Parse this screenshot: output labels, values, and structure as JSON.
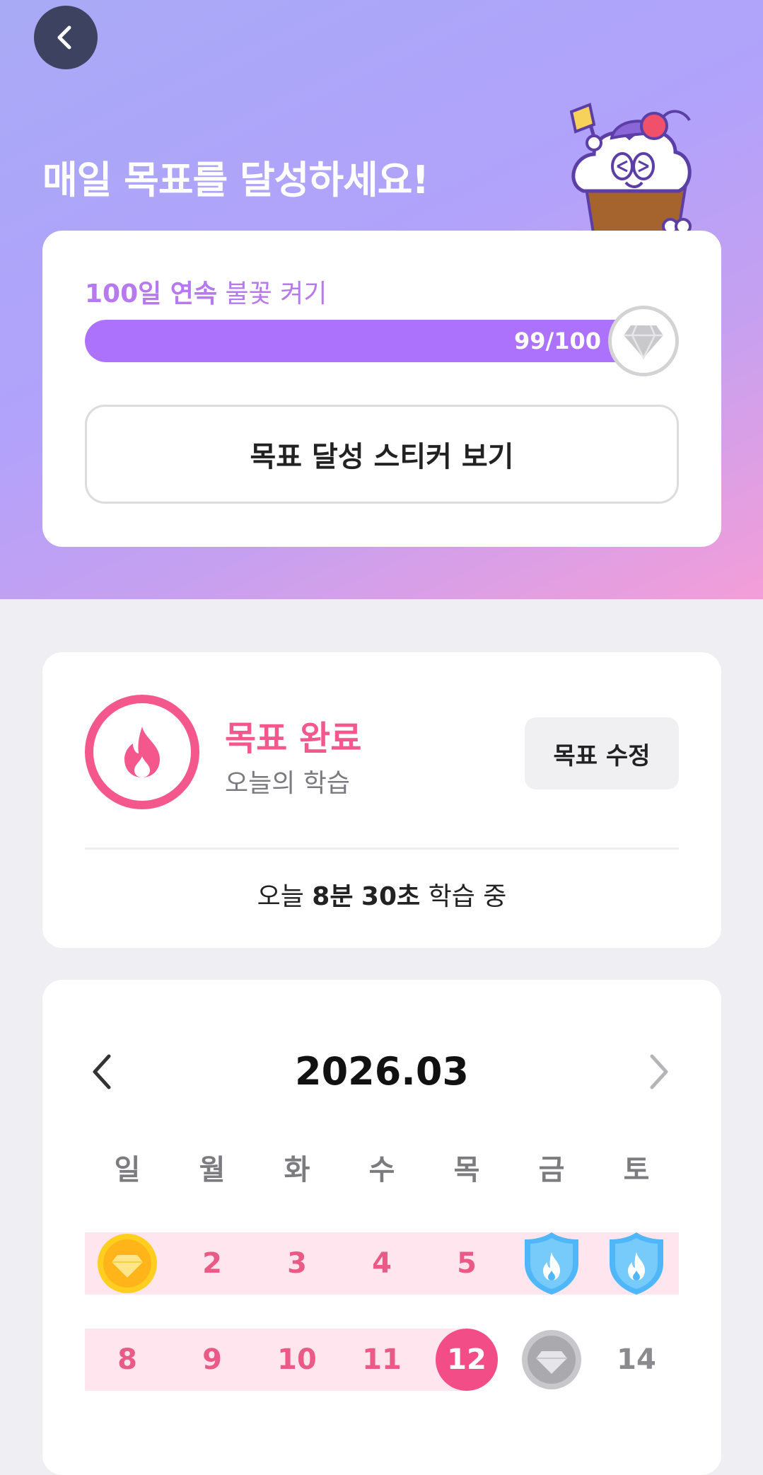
{
  "hero": {
    "title": "매일 목표를 달성하세요!"
  },
  "streak": {
    "label_strong": "100일 연속",
    "label_light": "불꽃 켜기",
    "progress_text": "99/100",
    "progress_value": 99,
    "progress_max": 100,
    "sticker_button": "목표 달성 스티커 보기"
  },
  "today": {
    "status": "목표 완료",
    "subtitle": "오늘의 학습",
    "edit_button": "목표 수정",
    "time_prefix": "오늘",
    "time_minutes": "8분",
    "time_seconds": "30초",
    "time_suffix": "학습 중"
  },
  "calendar": {
    "title": "2026.03",
    "weekdays": [
      "일",
      "월",
      "화",
      "수",
      "목",
      "금",
      "토"
    ],
    "week1": [
      "",
      "2",
      "3",
      "4",
      "5",
      "",
      ""
    ],
    "week1_icons": [
      "gold-diamond",
      "",
      "",
      "",
      "",
      "blue-shield-flame",
      "blue-shield-flame"
    ],
    "week2": [
      "8",
      "9",
      "10",
      "11",
      "12",
      "",
      "14"
    ],
    "week2_icons": [
      "",
      "",
      "",
      "",
      "today",
      "gray-diamond",
      ""
    ]
  },
  "colors": {
    "accent_purple": "#ad72fb",
    "accent_pink": "#f3578b",
    "streak_bg": "#ffe6ee"
  }
}
